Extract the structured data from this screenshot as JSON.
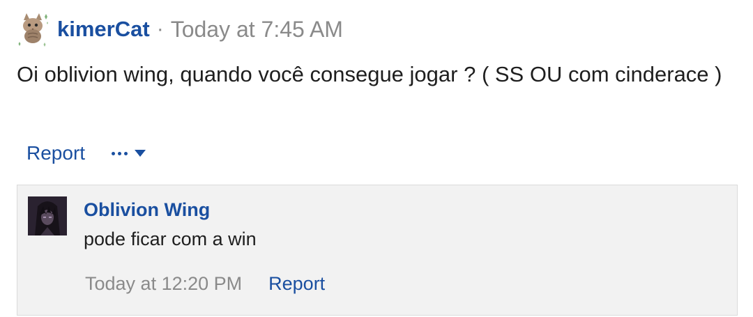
{
  "post": {
    "author": "kimerCat",
    "separator": "·",
    "timestamp": "Today at 7:45 AM",
    "text": "Oi oblivion wing, quando você consegue jogar ? ( SS OU com cinderace )",
    "avatar_icon": "cat-avatar",
    "actions": {
      "report_label": "Report",
      "more_icon": "ellipsis-icon",
      "dropdown_icon": "caret-down-icon"
    }
  },
  "reply": {
    "author": "Oblivion Wing",
    "text": "pode ficar com a win",
    "timestamp": "Today at 12:20 PM",
    "report_label": "Report",
    "avatar_icon": "dark-character-avatar"
  },
  "colors": {
    "link": "#1a4fa0",
    "muted": "#8a8a8a",
    "text": "#1e1e1e",
    "reply_bg": "#f2f2f2",
    "reply_border": "#dadada"
  }
}
